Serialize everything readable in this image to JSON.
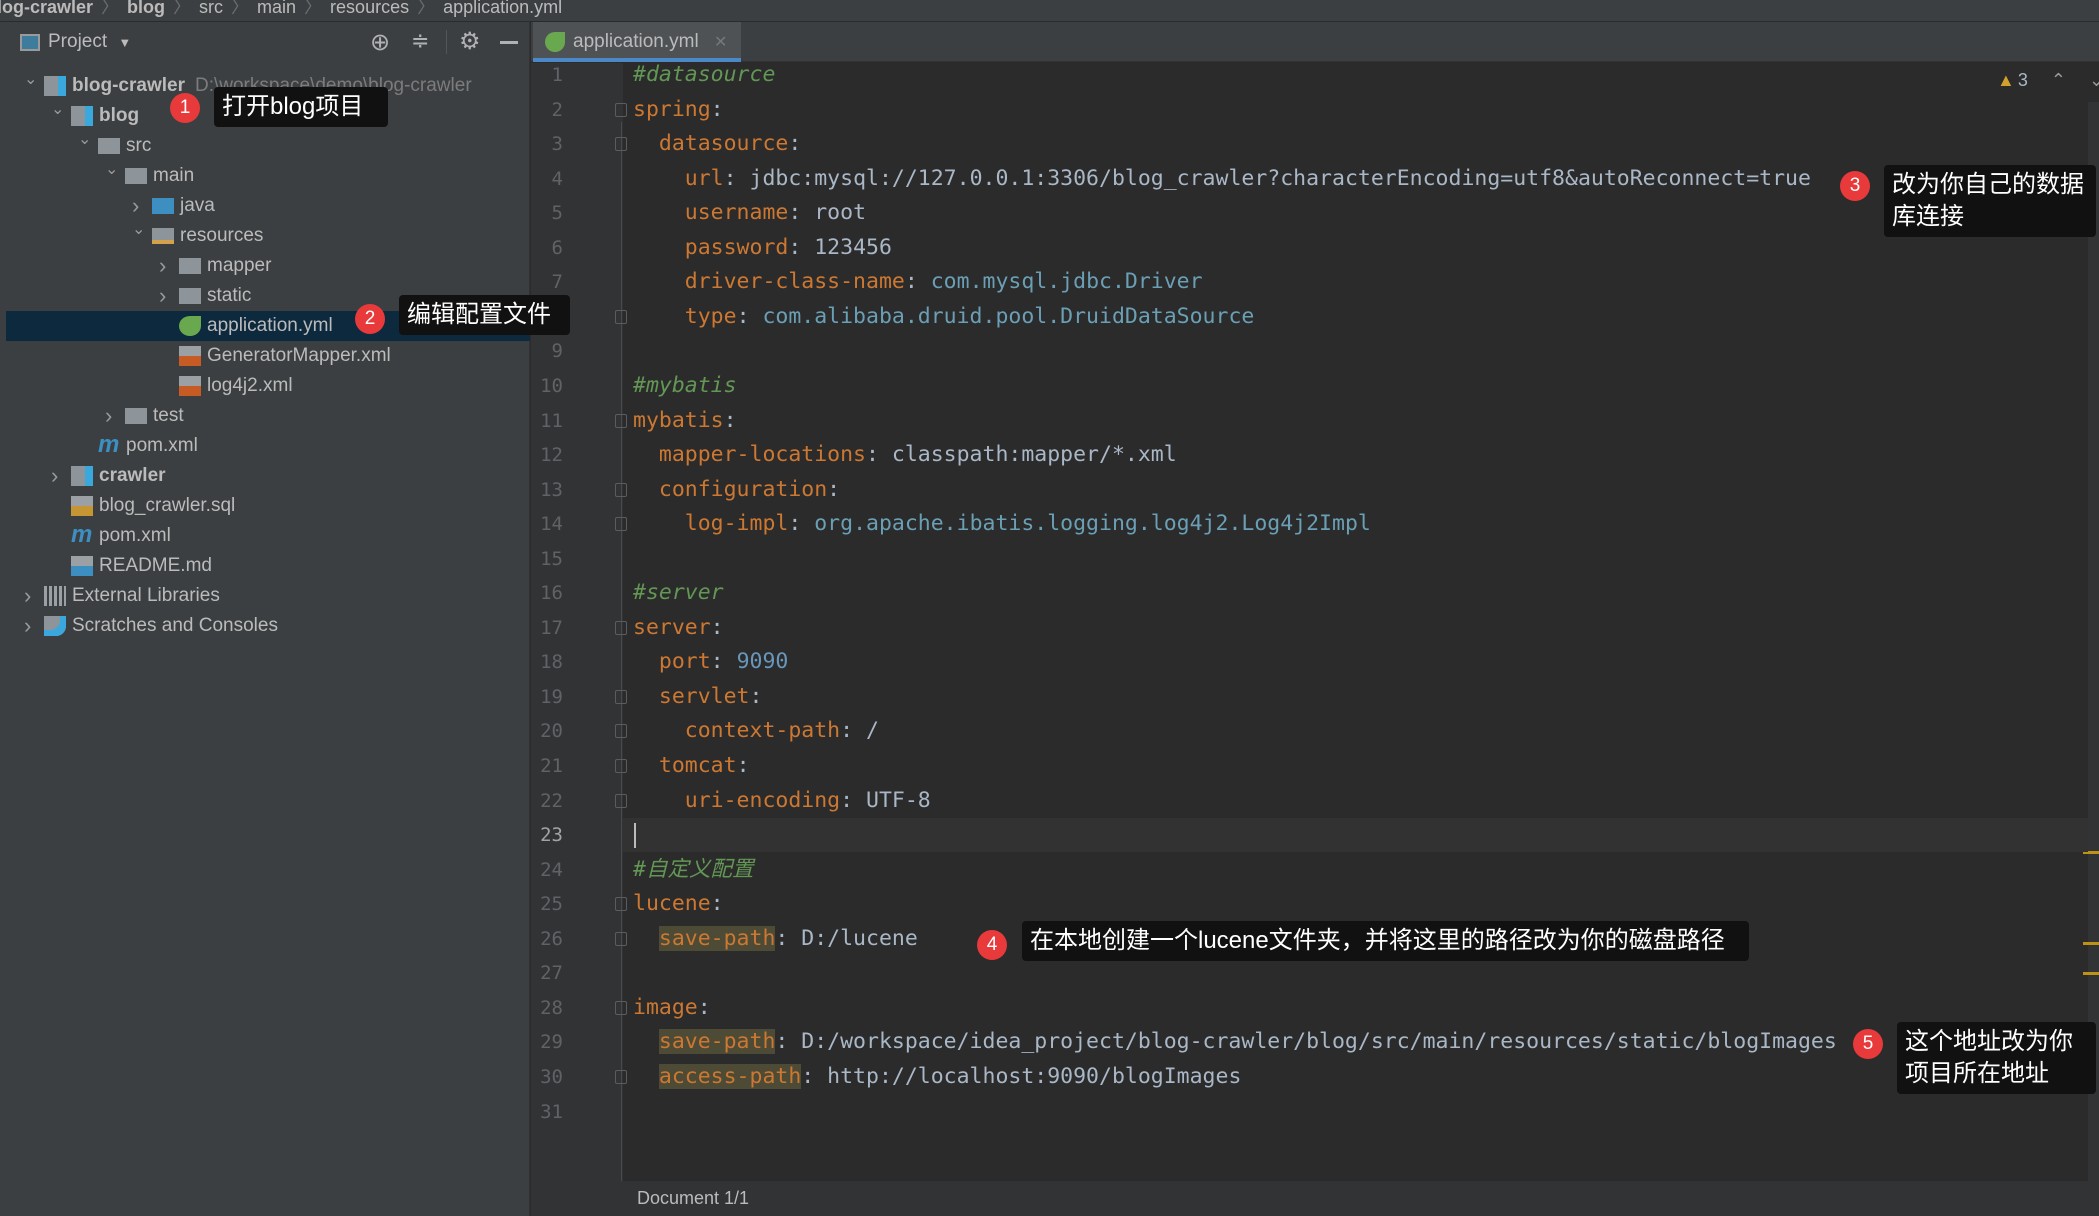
{
  "breadcrumb": [
    "blog-crawler",
    "blog",
    "src",
    "main",
    "resources",
    "application.yml"
  ],
  "project_panel": {
    "title": "Project"
  },
  "tree": [
    {
      "label": "blog-crawler",
      "hint": "D:\\workspace\\demo\\blog-crawler",
      "icon": "project-folder-icon",
      "level": 0,
      "chevron": "open",
      "bold": true
    },
    {
      "label": "blog",
      "icon": "project-folder-icon",
      "level": 1,
      "chevron": "open",
      "bold": true
    },
    {
      "label": "src",
      "icon": "folder-icon",
      "level": 2,
      "chevron": "open"
    },
    {
      "label": "main",
      "icon": "folder-icon",
      "level": 3,
      "chevron": "open"
    },
    {
      "label": "java",
      "icon": "source-folder-icon",
      "level": 4,
      "chevron": "closed"
    },
    {
      "label": "resources",
      "icon": "resources-folder-icon",
      "level": 4,
      "chevron": "open"
    },
    {
      "label": "mapper",
      "icon": "folder-icon",
      "level": 5,
      "chevron": "closed"
    },
    {
      "label": "static",
      "icon": "folder-icon",
      "level": 5,
      "chevron": "closed"
    },
    {
      "label": "application.yml",
      "icon": "spring-yml-icon",
      "level": 5,
      "selected": true
    },
    {
      "label": "GeneratorMapper.xml",
      "icon": "xml-file-icon",
      "level": 5
    },
    {
      "label": "log4j2.xml",
      "icon": "xml-file-icon",
      "level": 5
    },
    {
      "label": "test",
      "icon": "folder-icon",
      "level": 3,
      "chevron": "closed"
    },
    {
      "label": "pom.xml",
      "icon": "maven-icon",
      "level": 2
    },
    {
      "label": "crawler",
      "icon": "project-folder-icon",
      "level": 1,
      "chevron": "closed",
      "bold": true
    },
    {
      "label": "blog_crawler.sql",
      "icon": "sql-file-icon",
      "level": 1
    },
    {
      "label": "pom.xml",
      "icon": "maven-icon",
      "level": 1
    },
    {
      "label": "README.md",
      "icon": "md-file-icon",
      "level": 1
    },
    {
      "label": "External Libraries",
      "icon": "libraries-icon",
      "level": 0,
      "chevron": "closed"
    },
    {
      "label": "Scratches and Consoles",
      "icon": "scratches-icon",
      "level": 0,
      "chevron": "closed"
    }
  ],
  "editor": {
    "tab": "application.yml",
    "warnings": "3",
    "current_line": 23,
    "lines": [
      [
        [
          "cm",
          "#datasource"
        ]
      ],
      [
        [
          "k",
          "spring"
        ],
        [
          "p",
          ":"
        ]
      ],
      [
        [
          "p",
          "  "
        ],
        [
          "k",
          "datasource"
        ],
        [
          "p",
          ":"
        ]
      ],
      [
        [
          "p",
          "    "
        ],
        [
          "k",
          "url"
        ],
        [
          "p",
          ": "
        ],
        [
          "v",
          "jdbc:mysql://127.0.0.1:3306/blog_crawler?characterEncoding=utf8&autoReconnect=true"
        ]
      ],
      [
        [
          "p",
          "    "
        ],
        [
          "k",
          "username"
        ],
        [
          "p",
          ": "
        ],
        [
          "v",
          "root"
        ]
      ],
      [
        [
          "p",
          "    "
        ],
        [
          "k",
          "password"
        ],
        [
          "p",
          ": "
        ],
        [
          "v",
          "123456"
        ]
      ],
      [
        [
          "p",
          "    "
        ],
        [
          "k",
          "driver-class-name"
        ],
        [
          "p",
          ": "
        ],
        [
          "c",
          "com.mysql.jdbc.Driver"
        ]
      ],
      [
        [
          "p",
          "    "
        ],
        [
          "k",
          "type"
        ],
        [
          "p",
          ": "
        ],
        [
          "c",
          "com.alibaba.druid.pool.DruidDataSource"
        ]
      ],
      [],
      [
        [
          "cm",
          "#mybatis"
        ]
      ],
      [
        [
          "k",
          "mybatis"
        ],
        [
          "p",
          ":"
        ]
      ],
      [
        [
          "p",
          "  "
        ],
        [
          "k",
          "mapper-locations"
        ],
        [
          "p",
          ": "
        ],
        [
          "v",
          "classpath:mapper/*.xml"
        ]
      ],
      [
        [
          "p",
          "  "
        ],
        [
          "k",
          "configuration"
        ],
        [
          "p",
          ":"
        ]
      ],
      [
        [
          "p",
          "    "
        ],
        [
          "k",
          "log-impl"
        ],
        [
          "p",
          ": "
        ],
        [
          "c",
          "org.apache.ibatis.logging.log4j2.Log4j2Impl"
        ]
      ],
      [],
      [
        [
          "cm",
          "#server"
        ]
      ],
      [
        [
          "k",
          "server"
        ],
        [
          "p",
          ":"
        ]
      ],
      [
        [
          "p",
          "  "
        ],
        [
          "k",
          "port"
        ],
        [
          "p",
          ": "
        ],
        [
          "n",
          "9090"
        ]
      ],
      [
        [
          "p",
          "  "
        ],
        [
          "k",
          "servlet"
        ],
        [
          "p",
          ":"
        ]
      ],
      [
        [
          "p",
          "    "
        ],
        [
          "k",
          "context-path"
        ],
        [
          "p",
          ": "
        ],
        [
          "v",
          "/"
        ]
      ],
      [
        [
          "p",
          "  "
        ],
        [
          "k",
          "tomcat"
        ],
        [
          "p",
          ":"
        ]
      ],
      [
        [
          "p",
          "    "
        ],
        [
          "k",
          "uri-encoding"
        ],
        [
          "p",
          ": "
        ],
        [
          "v",
          "UTF-8"
        ]
      ],
      [],
      [
        [
          "cm",
          "#自定义配置"
        ]
      ],
      [
        [
          "k",
          "lucene"
        ],
        [
          "p",
          ":"
        ]
      ],
      [
        [
          "p",
          "  "
        ],
        [
          "kh",
          "save-path"
        ],
        [
          "p",
          ": "
        ],
        [
          "v",
          "D:/lucene"
        ]
      ],
      [],
      [
        [
          "k",
          "image"
        ],
        [
          "p",
          ":"
        ]
      ],
      [
        [
          "p",
          "  "
        ],
        [
          "kh",
          "save-path"
        ],
        [
          "p",
          ": "
        ],
        [
          "v",
          "D:/workspace/idea_project/blog-crawler/blog/src/main/resources/static/blogImages"
        ]
      ],
      [
        [
          "p",
          "  "
        ],
        [
          "kh",
          "access-path"
        ],
        [
          "p",
          ": "
        ],
        [
          "v",
          "http://localhost:9090/blogImages"
        ]
      ],
      []
    ]
  },
  "annotations": [
    {
      "number": "1",
      "text": "打开blog项目"
    },
    {
      "number": "2",
      "text": "编辑配置文件"
    },
    {
      "number": "3",
      "text": "改为你自己的数据库连接"
    },
    {
      "number": "4",
      "text": "在本地创建一个lucene文件夹，并将这里的路径改为你的磁盘路径"
    },
    {
      "number": "5",
      "text": "这个地址改为你项目所在地址"
    }
  ],
  "status": {
    "text": "Document 1/1"
  },
  "colors": {
    "accent": "#4a88c7",
    "annotation_badge": "#e83a3a",
    "key": "#cc7832",
    "comment": "#629755",
    "number": "#6897bb"
  }
}
